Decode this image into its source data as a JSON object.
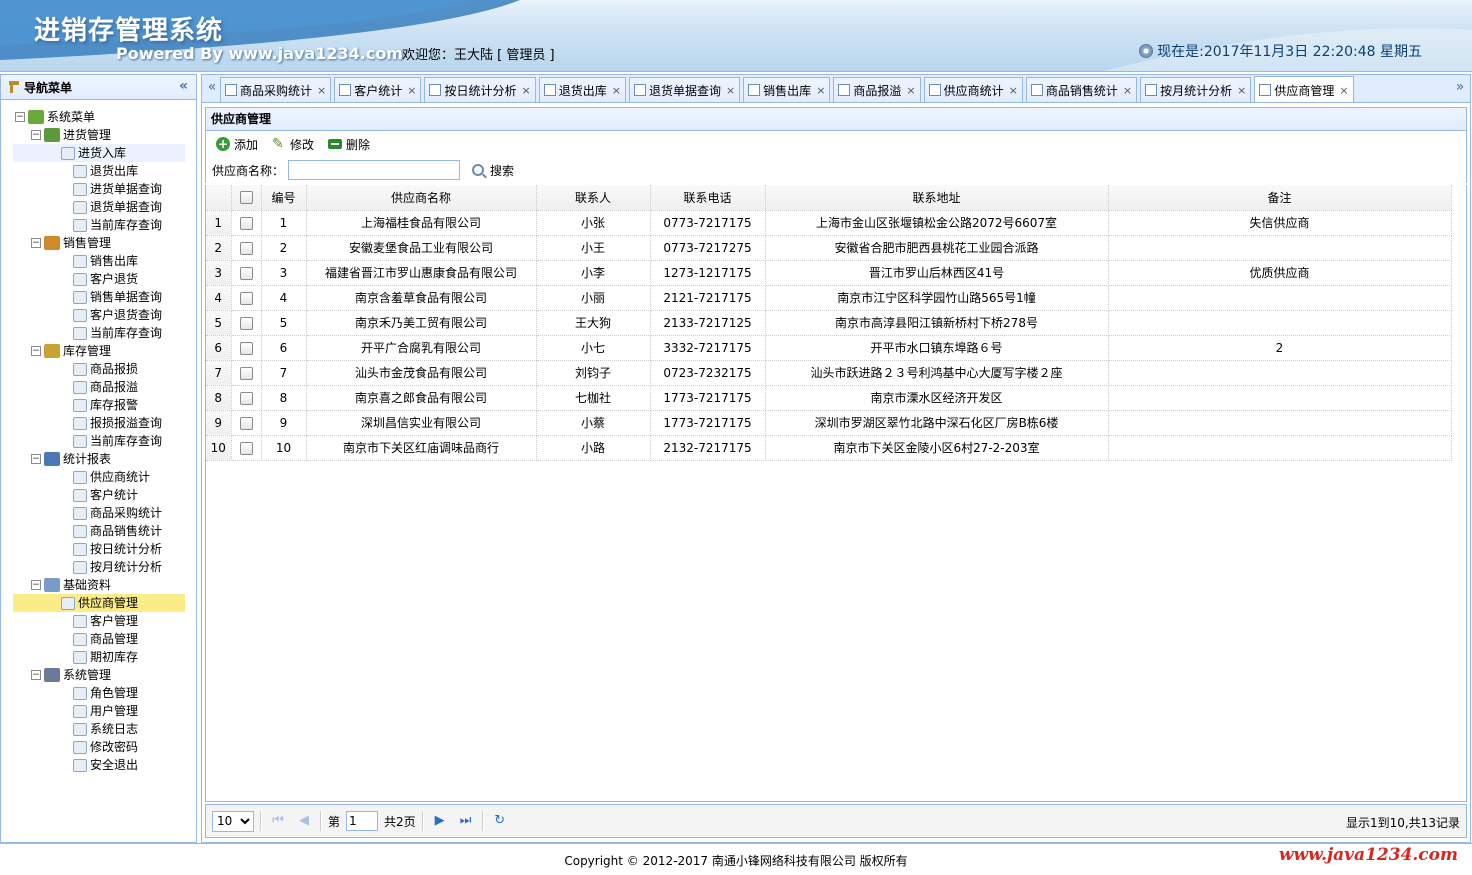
{
  "header": {
    "title": "进销存管理系统",
    "powered": "Powered By www.java1234.com",
    "welcome": "欢迎您：王大陆 [ 管理员 ]",
    "datetime": "现在是:2017年11月3日 22:20:48 星期五"
  },
  "nav": {
    "title": "导航菜单",
    "collapse": "«",
    "root": "系统菜单",
    "groups": [
      {
        "label": "进货管理",
        "items": [
          "进货入库",
          "退货出库",
          "进货单据查询",
          "退货单据查询",
          "当前库存查询"
        ]
      },
      {
        "label": "销售管理",
        "items": [
          "销售出库",
          "客户退货",
          "销售单据查询",
          "客户退货查询",
          "当前库存查询"
        ]
      },
      {
        "label": "库存管理",
        "items": [
          "商品报损",
          "商品报溢",
          "库存报警",
          "报损报溢查询",
          "当前库存查询"
        ]
      },
      {
        "label": "统计报表",
        "items": [
          "供应商统计",
          "客户统计",
          "商品采购统计",
          "商品销售统计",
          "按日统计分析",
          "按月统计分析"
        ]
      },
      {
        "label": "基础资料",
        "items": [
          "供应商管理",
          "客户管理",
          "商品管理",
          "期初库存"
        ]
      },
      {
        "label": "系统管理",
        "items": [
          "角色管理",
          "用户管理",
          "系统日志",
          "修改密码",
          "安全退出"
        ]
      }
    ]
  },
  "tabs": {
    "left_scroll": "«",
    "right_scroll": "»",
    "close": "×",
    "items": [
      "商品采购统计",
      "客户统计",
      "按日统计分析",
      "退货出库",
      "退货单据查询",
      "销售出库",
      "商品报溢",
      "供应商统计",
      "商品销售统计",
      "按月统计分析",
      "供应商管理"
    ]
  },
  "panel": {
    "title": "供应商管理",
    "toolbar": {
      "add": "添加",
      "edit": "修改",
      "delete": "删除"
    },
    "search": {
      "label": "供应商名称：",
      "value": "",
      "button": "搜索"
    }
  },
  "grid": {
    "columns": [
      "编号",
      "供应商名称",
      "联系人",
      "联系电话",
      "联系地址",
      "备注"
    ],
    "rows": [
      [
        "1",
        "上海福桂食品有限公司",
        "小张",
        "0773-7217175",
        "上海市金山区张堰镇松金公路2072号6607室",
        "失信供应商"
      ],
      [
        "2",
        "安徽麦堡食品工业有限公司",
        "小王",
        "0773-7217275",
        "安徽省合肥市肥西县桃花工业园合派路",
        ""
      ],
      [
        "3",
        "福建省晋江市罗山惠康食品有限公司",
        "小李",
        "1273-1217175",
        "晋江市罗山后林西区41号",
        "优质供应商"
      ],
      [
        "4",
        "南京含羞草食品有限公司",
        "小丽",
        "2121-7217175",
        "南京市江宁区科学园竹山路565号1幢",
        ""
      ],
      [
        "5",
        "南京禾乃美工贸有限公司",
        "王大狗",
        "2133-7217125",
        "南京市高淳县阳江镇新桥村下桥278号",
        ""
      ],
      [
        "6",
        "开平广合腐乳有限公司",
        "小七",
        "3332-7217175",
        "开平市水口镇东埠路６号",
        "2"
      ],
      [
        "7",
        "汕头市金茂食品有限公司",
        "刘钧子",
        "0723-7232175",
        "汕头市跃进路２３号利鸿基中心大厦写字楼２座",
        ""
      ],
      [
        "8",
        "南京喜之郎食品有限公司",
        "七枷社",
        "1773-7217175",
        "南京市溧水区经济开发区",
        ""
      ],
      [
        "9",
        "深圳昌信实业有限公司",
        "小蔡",
        "1773-7217175",
        "深圳市罗湖区翠竹北路中深石化区厂房B栋6楼",
        ""
      ],
      [
        "10",
        "南京市下关区红庙调味品商行",
        "小路",
        "2132-7217175",
        "南京市下关区金陵小区6村27-2-203室",
        ""
      ]
    ]
  },
  "pager": {
    "page_size": "10",
    "page_prefix": "第",
    "page_value": "1",
    "page_total": "共2页",
    "info": "显示1到10,共13记录"
  },
  "footer": {
    "copyright": "Copyright © 2012-2017 南通小锋网络科技有限公司 版权所有",
    "watermark": "www.java1234.com"
  }
}
